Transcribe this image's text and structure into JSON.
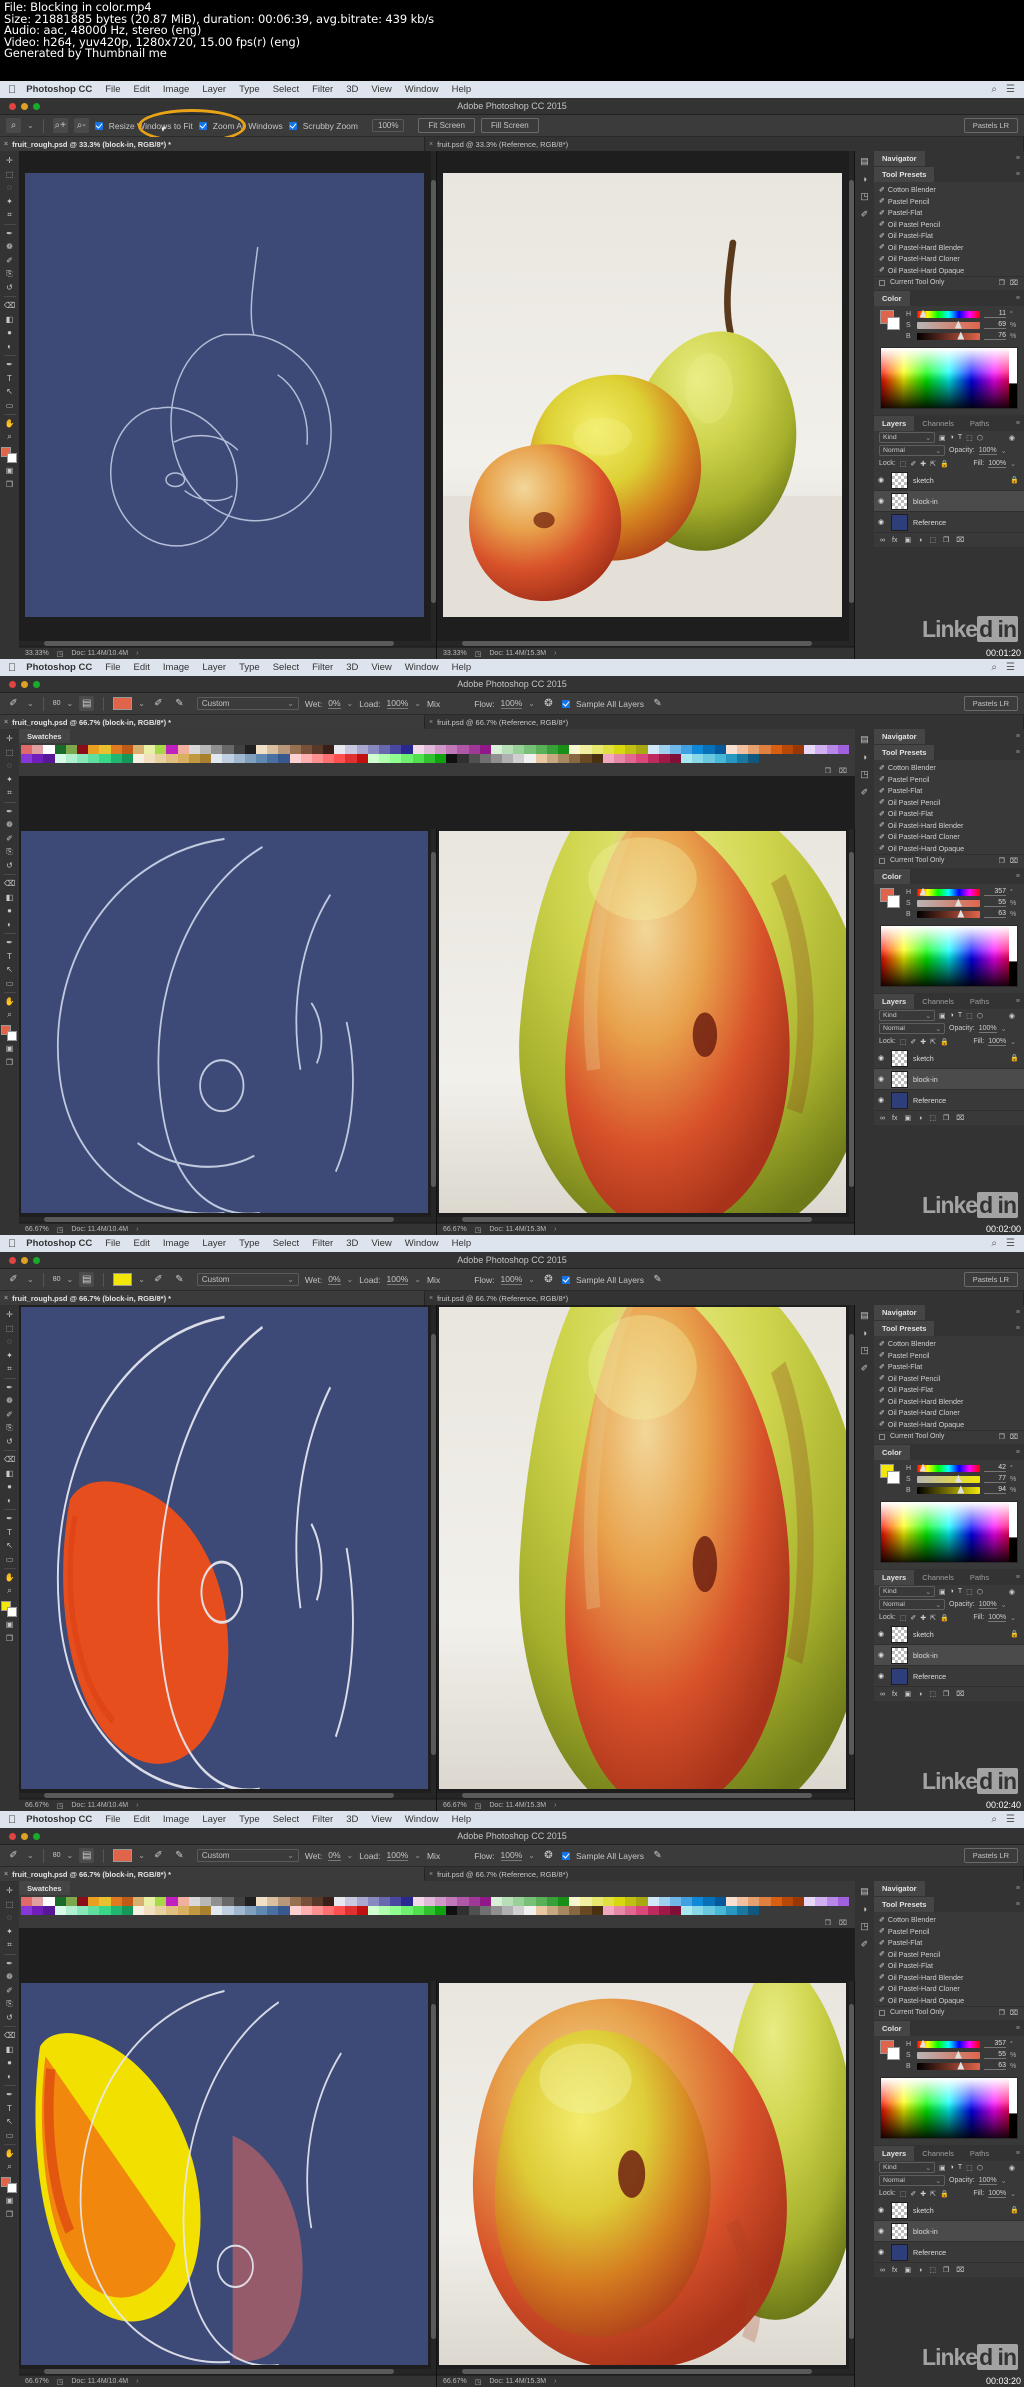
{
  "file_info": {
    "line1": "File: Blocking in color.mp4",
    "line2": "Size: 21881885 bytes (20.87 MiB), duration: 00:06:39, avg.bitrate: 439 kb/s",
    "line3": "Audio: aac, 48000 Hz, stereo (eng)",
    "line4": "Video: h264, yuv420p, 1280x720, 15.00 fps(r) (eng)",
    "line5": "Generated by Thumbnail me"
  },
  "menubar": {
    "apple": "",
    "brand": "Photoshop CC",
    "items": [
      "File",
      "Edit",
      "Image",
      "Layer",
      "Type",
      "Select",
      "Filter",
      "3D",
      "View",
      "Window",
      "Help"
    ],
    "search_icon": "⌕",
    "arrange_icon": "☰"
  },
  "window": {
    "app_title": "Adobe Photoshop CC 2015"
  },
  "workspace": {
    "label": "Pastels LR"
  },
  "zoom_options": {
    "tool_icon": "⌕",
    "chevron": "⌄",
    "zoom_in_icon": "⌕+",
    "zoom_out_icon": "⌕-",
    "resize_windows": "Resize Windows to Fit",
    "zoom_all_windows": "Zoom All Windows",
    "scrubby_zoom": "Scrubby Zoom",
    "zoom_value": "100%",
    "fit_screen": "Fit Screen",
    "fill_screen": "Fill Screen"
  },
  "brush_options": {
    "brush_icon": "✐",
    "chevron": "⌄",
    "size_value": "80",
    "preset_icon": "▤",
    "mode_label": "Custom",
    "wet_label": "Wet:",
    "wet_value": "0%",
    "load_label": "Load:",
    "load_value": "100%",
    "mix_label": "Mix",
    "flow_label": "Flow:",
    "flow_value": "100%",
    "airbrush_icon": "❂",
    "sample_all_layers": "Sample All Layers",
    "smoothing_icon": "✎"
  },
  "panels": [
    {
      "id": "panel1",
      "timestamp": "00:01:20",
      "zoom": "33.33%",
      "fg_color": "#e0644a",
      "tabs": [
        {
          "label": "fruit_rough.psd @ 33.3% (block-in, RGB/8*) *",
          "active": true
        },
        {
          "label": "fruit.psd @ 33.3% (Reference, RGB/8*)",
          "active": false
        }
      ],
      "options_bar": "zoom",
      "has_swatches": false,
      "status_left": {
        "zoom": "33.33%",
        "doc": "Doc: 11.4M/10.4M"
      },
      "status_right": {
        "zoom": "33.33%",
        "doc": "Doc: 11.4M/15.3M"
      },
      "color": {
        "h": "11",
        "h_unit": "°",
        "s": "69",
        "s_unit": "%",
        "b": "76",
        "b_unit": "%"
      },
      "artwork": "sketch-only"
    },
    {
      "id": "panel2",
      "timestamp": "00:02:00",
      "zoom": "66.67%",
      "fg_color": "#e0644a",
      "tabs": [
        {
          "label": "fruit_rough.psd @ 66.7% (block-in, RGB/8*) *",
          "active": true
        },
        {
          "label": "fruit.psd @ 66.7% (Reference, RGB/8*)",
          "active": false
        }
      ],
      "options_bar": "brush",
      "has_swatches": true,
      "status_left": {
        "zoom": "66.67%",
        "doc": "Doc: 11.4M/10.4M"
      },
      "status_right": {
        "zoom": "66.67%",
        "doc": "Doc: 11.4M/15.3M"
      },
      "color": {
        "h": "357",
        "h_unit": "°",
        "s": "55",
        "s_unit": "%",
        "b": "63",
        "b_unit": "%"
      },
      "artwork": "sketch-closeup"
    },
    {
      "id": "panel3",
      "timestamp": "00:02:40",
      "zoom": "66.67%",
      "fg_color": "#f2e707",
      "tabs": [
        {
          "label": "fruit_rough.psd @ 66.7% (block-in, RGB/8*) *",
          "active": true
        },
        {
          "label": "fruit.psd @ 66.7% (Reference, RGB/8*)",
          "active": false
        }
      ],
      "options_bar": "brush",
      "has_swatches": false,
      "status_left": {
        "zoom": "66.67%",
        "doc": "Doc: 11.4M/10.4M"
      },
      "status_right": {
        "zoom": "66.67%",
        "doc": "Doc: 11.4M/15.3M"
      },
      "color": {
        "h": "42",
        "h_unit": "°",
        "s": "77",
        "s_unit": "%",
        "b": "94",
        "b_unit": "%"
      },
      "artwork": "orange-blockin"
    },
    {
      "id": "panel4",
      "timestamp": "00:03:20",
      "zoom": "66.67%",
      "fg_color": "#e0644a",
      "tabs": [
        {
          "label": "fruit_rough.psd @ 66.7% (block-in, RGB/8*) *",
          "active": true
        },
        {
          "label": "fruit.psd @ 66.7% (Reference, RGB/8*)",
          "active": false
        }
      ],
      "options_bar": "brush",
      "has_swatches": true,
      "status_left": {
        "zoom": "66.67%",
        "doc": "Doc: 11.4M/10.4M"
      },
      "status_right": {
        "zoom": "66.67%",
        "doc": "Doc: 11.4M/15.3M"
      },
      "color": {
        "h": "357",
        "h_unit": "°",
        "s": "55",
        "s_unit": "%",
        "b": "63",
        "b_unit": "%"
      },
      "artwork": "yellow-blockin"
    }
  ],
  "navigator": {
    "title": "Navigator"
  },
  "tool_presets": {
    "title": "Tool Presets",
    "items": [
      "Cotton Blender",
      "Pastel Pencil",
      "Pastel-Flat",
      "Oil Pastel Pencil",
      "Oil Pastel-Flat",
      "Oil Pastel-Hard Blender",
      "Oil Pastel-Hard Cloner",
      "Oil Pastel-Hard Opaque"
    ],
    "current_tool_only": "Current Tool Only",
    "new_icon": "❐",
    "delete_icon": "⌧"
  },
  "color_panel": {
    "title": "Color"
  },
  "layers_panel": {
    "tabs": [
      "Layers",
      "Channels",
      "Paths"
    ],
    "active_tab": "Layers",
    "filter_label": "Kind",
    "filter_icon": "⌕",
    "filter_icons": [
      "▣",
      "◑",
      "T",
      "⬚",
      "⬡"
    ],
    "blend_mode": "Normal",
    "opacity_label": "Opacity:",
    "opacity_value": "100%",
    "lock_label": "Lock:",
    "lock_icons": [
      "⬚",
      "✐",
      "✚",
      "⇱",
      "🔒"
    ],
    "fill_label": "Fill:",
    "fill_value": "100%",
    "layers": [
      {
        "name": "sketch",
        "visible": true,
        "locked": true,
        "selected": false,
        "type": "transparent"
      },
      {
        "name": "block-in",
        "visible": true,
        "locked": false,
        "selected": true,
        "type": "transparent"
      },
      {
        "name": "Reference",
        "visible": true,
        "locked": false,
        "selected": false,
        "type": "solid",
        "color": "#2d3e7a"
      }
    ],
    "footer_icons": [
      "∞",
      "fx",
      "▣",
      "◑",
      "⬚",
      "❐",
      "⌧"
    ]
  },
  "swatches_panel": {
    "title": "Swatches",
    "new_icon": "❐",
    "delete_icon": "⌧"
  },
  "tools": [
    "move-tool",
    "marquee-tool",
    "lasso-tool",
    "quick-select-tool",
    "crop-tool",
    "eyedropper-tool",
    "healing-brush-tool",
    "brush-tool",
    "clone-stamp-tool",
    "history-brush-tool",
    "eraser-tool",
    "gradient-tool",
    "blur-tool",
    "dodge-tool",
    "pen-tool",
    "type-tool",
    "path-select-tool",
    "shape-tool",
    "hand-tool",
    "zoom-tool"
  ],
  "right_dock_icons": [
    "color-panel-icon",
    "adjustments-icon",
    "history-icon",
    "brush-settings-icon"
  ],
  "watermark": {
    "text": "Linke",
    "boxed": "d in"
  }
}
